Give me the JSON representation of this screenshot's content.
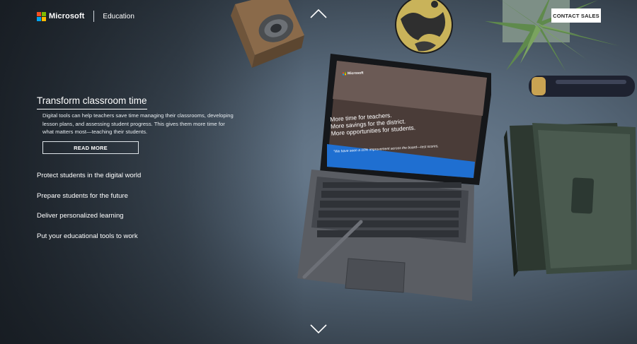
{
  "header": {
    "brand_name": "Microsoft",
    "section": "Education",
    "cta_label": "CONTACT SALES"
  },
  "logo_colors": [
    "#f25022",
    "#7fba00",
    "#00a4ef",
    "#ffb900"
  ],
  "hero": {
    "title": "Transform classroom time",
    "body": "Digital tools can help teachers save time managing their classrooms, developing lesson plans, and assessing student progress. This gives them more time for what matters most—teaching their students.",
    "button_label": "READ MORE"
  },
  "nav_items": [
    {
      "label": "Protect students in the digital world"
    },
    {
      "label": "Prepare students for the future"
    },
    {
      "label": "Deliver personalized learning"
    },
    {
      "label": "Put your educational tools to work"
    }
  ],
  "tablet_screen": {
    "brand": "Microsoft",
    "headline_lines": [
      "More time for teachers.",
      "More savings for the district.",
      "More opportunities for students."
    ],
    "banner": "\"We have seen a 10% improvement across the board—test scores,"
  },
  "icons": {
    "up": "chevron-up-icon",
    "down": "chevron-down-icon"
  },
  "colors": {
    "accent_blue": "#1f6fd1",
    "text": "#ffffff"
  }
}
